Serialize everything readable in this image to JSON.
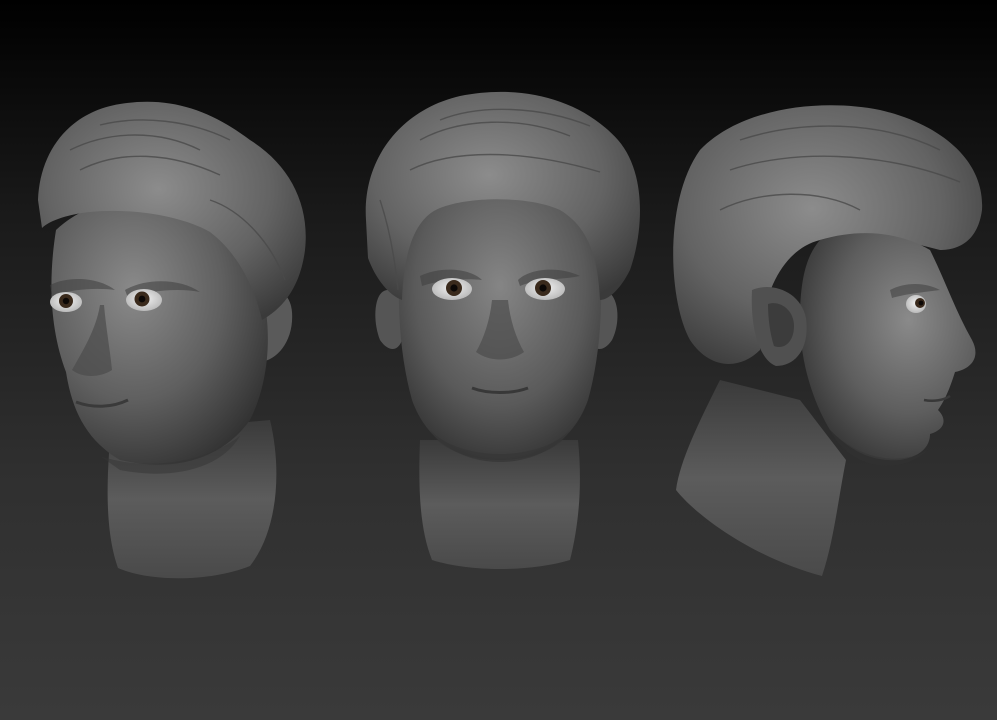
{
  "scene": {
    "background_top": "#000000",
    "background_bottom": "#3a3a3a",
    "material_color": "#6e6e6e",
    "iris_color": "#3a2a1c",
    "views": [
      {
        "view": "three-quarter-left"
      },
      {
        "view": "front"
      },
      {
        "view": "profile-right"
      }
    ]
  }
}
